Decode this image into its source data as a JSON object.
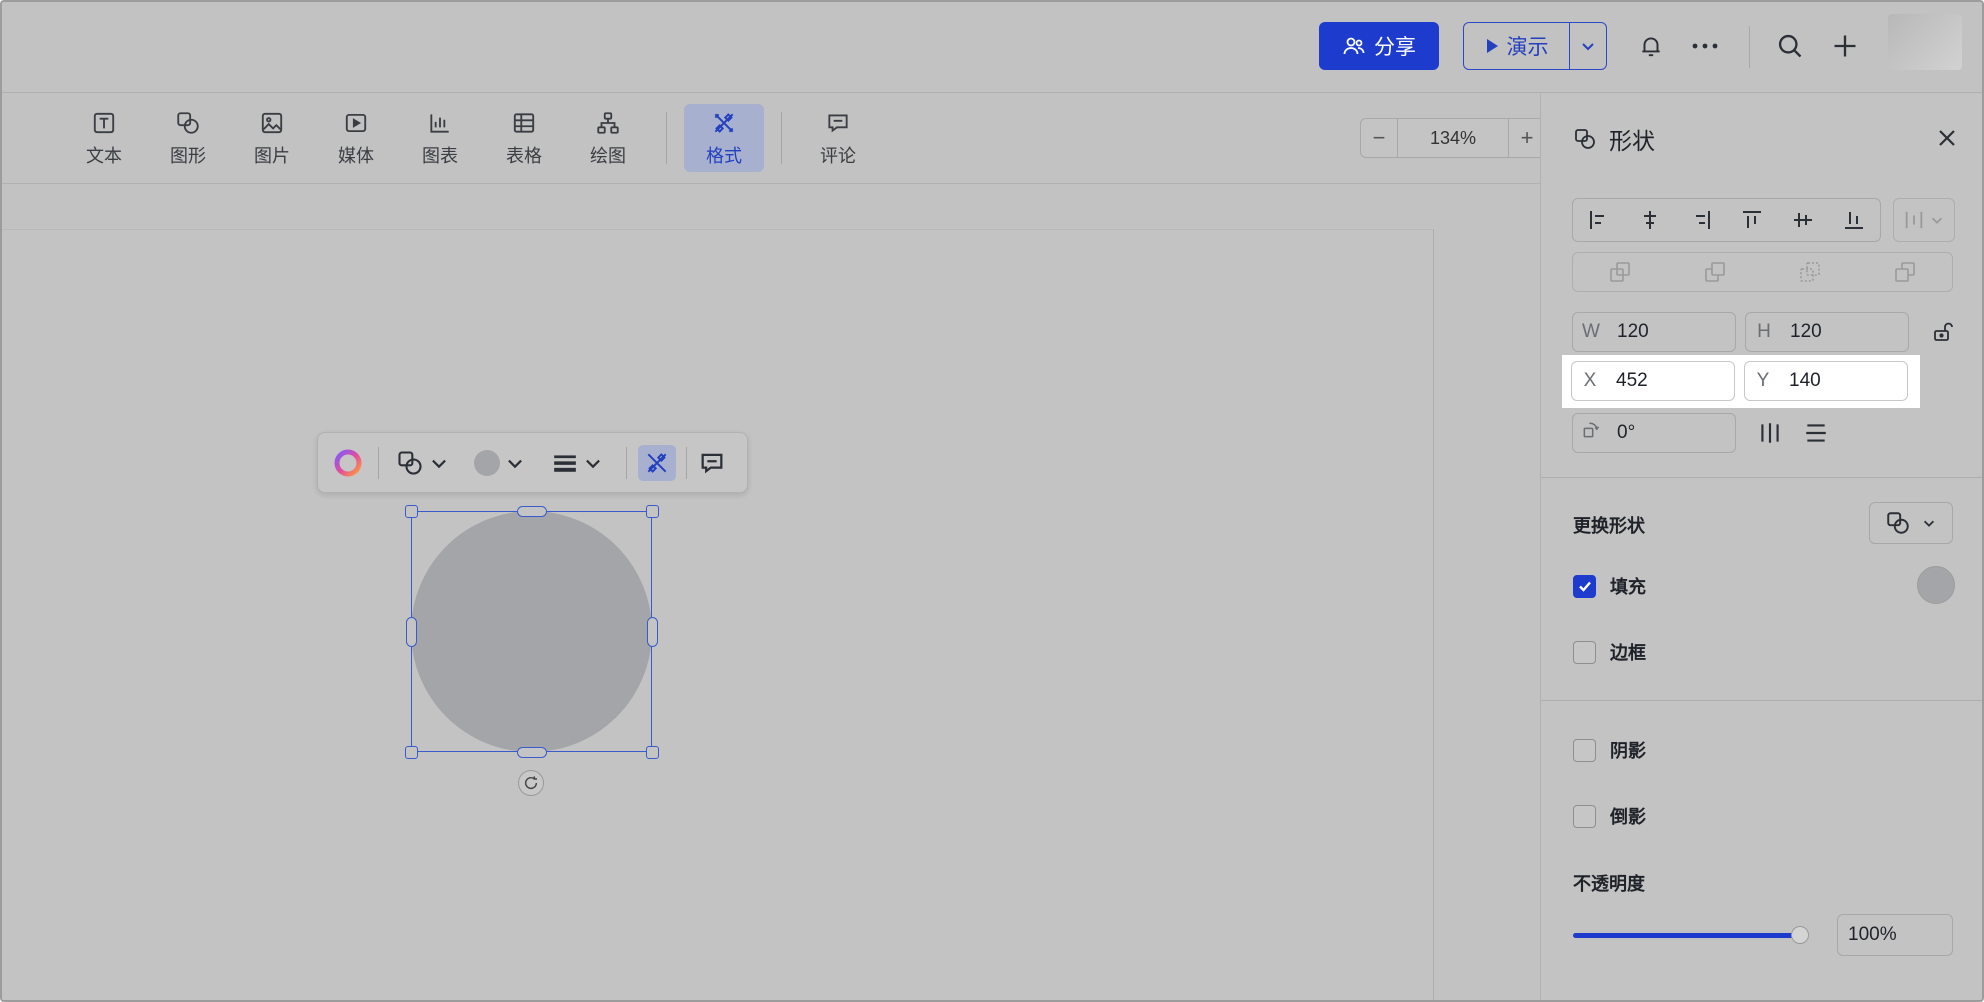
{
  "header": {
    "share_label": "分享",
    "present_label": "演示"
  },
  "toolbar": {
    "items": [
      {
        "label": "文本",
        "icon": "text-icon"
      },
      {
        "label": "图形",
        "icon": "shape-icon"
      },
      {
        "label": "图片",
        "icon": "image-icon"
      },
      {
        "label": "媒体",
        "icon": "media-icon"
      },
      {
        "label": "图表",
        "icon": "chart-icon"
      },
      {
        "label": "表格",
        "icon": "table-icon"
      },
      {
        "label": "绘图",
        "icon": "diagram-icon"
      },
      {
        "label": "格式",
        "icon": "format-icon",
        "active": true
      },
      {
        "label": "评论",
        "icon": "comment-icon"
      }
    ],
    "zoom": "134%",
    "zoom_minus": "−",
    "zoom_plus": "+"
  },
  "colors": {
    "accent": "#1d3bcc",
    "shape_fill": "#a4a5a8",
    "selection": "#3b5bcc"
  },
  "panel": {
    "title": "形状",
    "w_label": "W",
    "w_value": "120",
    "h_label": "H",
    "h_value": "120",
    "x_label": "X",
    "x_value": "452",
    "y_label": "Y",
    "y_value": "140",
    "rotation_value": "0°",
    "change_shape_label": "更换形状",
    "fill_label": "填充",
    "fill_checked": true,
    "border_label": "边框",
    "border_checked": false,
    "shadow_label": "阴影",
    "shadow_checked": false,
    "reflection_label": "倒影",
    "reflection_checked": false,
    "opacity_label": "不透明度",
    "opacity_value": "100%",
    "opacity_level": 1.0
  }
}
